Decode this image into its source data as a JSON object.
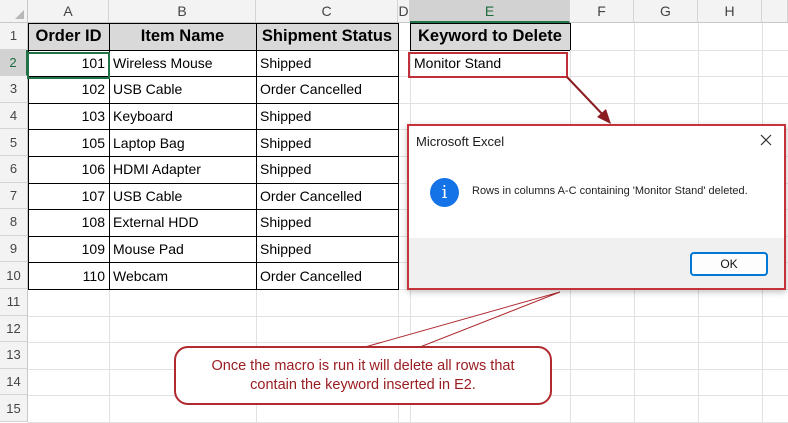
{
  "columns": [
    "A",
    "B",
    "C",
    "D",
    "E",
    "F",
    "G",
    "H"
  ],
  "rows": [
    "1",
    "2",
    "3",
    "4",
    "5",
    "6",
    "7",
    "8",
    "9",
    "10",
    "11",
    "12",
    "13",
    "14",
    "15"
  ],
  "table": {
    "headers": [
      "Order ID",
      "Item Name",
      "Shipment Status"
    ],
    "data": [
      [
        "101",
        "Wireless Mouse",
        "Shipped"
      ],
      [
        "102",
        "USB Cable",
        "Order Cancelled"
      ],
      [
        "103",
        "Keyboard",
        "Shipped"
      ],
      [
        "105",
        "Laptop Bag",
        "Shipped"
      ],
      [
        "106",
        "HDMI Adapter",
        "Shipped"
      ],
      [
        "107",
        "USB Cable",
        "Order Cancelled"
      ],
      [
        "108",
        "External HDD",
        "Shipped"
      ],
      [
        "109",
        "Mouse Pad",
        "Shipped"
      ],
      [
        "110",
        "Webcam",
        "Order Cancelled"
      ]
    ]
  },
  "keyword": {
    "header": "Keyword to Delete",
    "value": "Monitor Stand"
  },
  "dialog": {
    "title": "Microsoft Excel",
    "message": "Rows in columns A-C containing 'Monitor Stand' deleted.",
    "ok_label": "OK",
    "icon": "info-icon"
  },
  "callout": {
    "line1": "Once the macro is run it will delete all rows that",
    "line2": "contain the keyword inserted in E2."
  },
  "colors": {
    "accent_red": "#c0303a",
    "excel_green": "#217346",
    "info_blue": "#1473e6"
  }
}
